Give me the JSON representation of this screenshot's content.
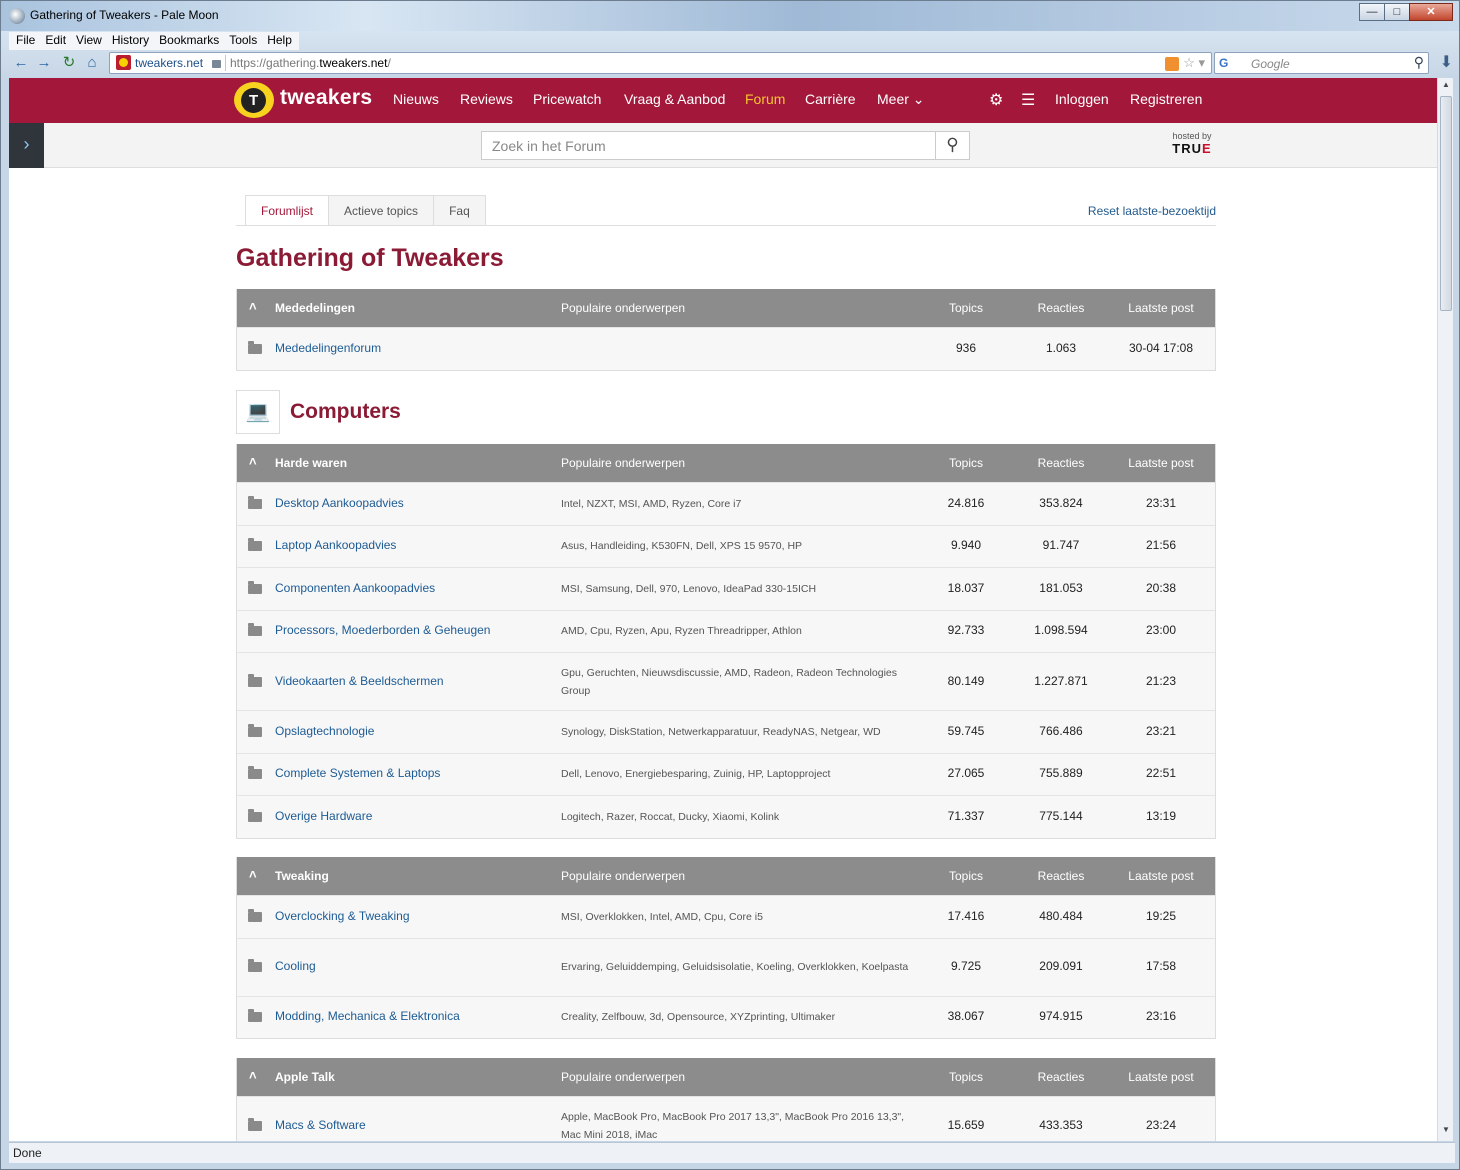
{
  "window": {
    "title": "Gathering of Tweakers - Pale Moon"
  },
  "menu": [
    "File",
    "Edit",
    "View",
    "History",
    "Bookmarks",
    "Tools",
    "Help"
  ],
  "address": {
    "site": "tweakers.net",
    "url_prefix": "https://gathering.",
    "url_domain": "tweakers.net",
    "url_suffix": "/"
  },
  "browser_search": {
    "engine": "G",
    "placeholder": "Google"
  },
  "status": "Done",
  "site": {
    "logo_text": "tweakers",
    "nav": [
      "Nieuws",
      "Reviews",
      "Pricewatch",
      "Vraag & Aanbod",
      "Forum",
      "Carrière",
      "Meer"
    ],
    "login": "Inloggen",
    "register": "Registreren",
    "search_placeholder": "Zoek in het Forum",
    "hosted_by": "hosted by",
    "hosted_logo": "TRU",
    "hosted_logo_accent": "E"
  },
  "tabs": [
    "Forumlijst",
    "Actieve topics",
    "Faq"
  ],
  "reset_link": "Reset laatste-bezoektijd",
  "page_title": "Gathering of Tweakers",
  "col_headers": {
    "popular": "Populaire onderwerpen",
    "topics": "Topics",
    "reacties": "Reacties",
    "last": "Laatste post"
  },
  "category": {
    "name": "Computers",
    "icon": "laptop-icon"
  },
  "sections": [
    {
      "name": "Mededelingen",
      "forums": [
        {
          "name": "Mededelingenforum",
          "popular": "",
          "topics": "936",
          "reacties": "1.063",
          "last": "30-04 17:08"
        }
      ]
    },
    {
      "name": "Harde waren",
      "forums": [
        {
          "name": "Desktop Aankoopadvies",
          "popular": "Intel, NZXT, MSI, AMD, Ryzen, Core i7",
          "topics": "24.816",
          "reacties": "353.824",
          "last": "23:31"
        },
        {
          "name": "Laptop Aankoopadvies",
          "popular": "Asus, Handleiding, K530FN, Dell, XPS 15 9570, HP",
          "topics": "9.940",
          "reacties": "91.747",
          "last": "21:56"
        },
        {
          "name": "Componenten Aankoopadvies",
          "popular": "MSI, Samsung, Dell, 970, Lenovo, IdeaPad 330-15ICH",
          "topics": "18.037",
          "reacties": "181.053",
          "last": "20:38"
        },
        {
          "name": "Processors, Moederborden & Geheugen",
          "popular": "AMD, Cpu, Ryzen, Apu, Ryzen Threadripper, Athlon",
          "topics": "92.733",
          "reacties": "1.098.594",
          "last": "23:00"
        },
        {
          "name": "Videokaarten & Beeldschermen",
          "popular": "Gpu, Geruchten, Nieuwsdiscussie, AMD, Radeon, Radeon Technologies Group",
          "topics": "80.149",
          "reacties": "1.227.871",
          "last": "21:23"
        },
        {
          "name": "Opslagtechnologie",
          "popular": "Synology, DiskStation, Netwerkapparatuur, ReadyNAS, Netgear, WD",
          "topics": "59.745",
          "reacties": "766.486",
          "last": "23:21"
        },
        {
          "name": "Complete Systemen & Laptops",
          "popular": "Dell, Lenovo, Energiebesparing, Zuinig, HP, Laptopproject",
          "topics": "27.065",
          "reacties": "755.889",
          "last": "22:51"
        },
        {
          "name": "Overige Hardware",
          "popular": "Logitech, Razer, Roccat, Ducky, Xiaomi, Kolink",
          "topics": "71.337",
          "reacties": "775.144",
          "last": "13:19"
        }
      ]
    },
    {
      "name": "Tweaking",
      "forums": [
        {
          "name": "Overclocking & Tweaking",
          "popular": "MSI, Overklokken, Intel, AMD, Cpu, Core i5",
          "topics": "17.416",
          "reacties": "480.484",
          "last": "19:25"
        },
        {
          "name": "Cooling",
          "popular": "Ervaring, Geluiddemping, Geluidsisolatie, Koeling, Overklokken, Koelpasta",
          "topics": "9.725",
          "reacties": "209.091",
          "last": "17:58"
        },
        {
          "name": "Modding, Mechanica & Elektronica",
          "popular": "Creality, Zelfbouw, 3d, Opensource, XYZprinting, Ultimaker",
          "topics": "38.067",
          "reacties": "974.915",
          "last": "23:16"
        }
      ]
    },
    {
      "name": "Apple Talk",
      "forums": [
        {
          "name": "Macs & Software",
          "popular": "Apple, MacBook Pro, MacBook Pro 2017 13,3\", MacBook Pro 2016 13,3\", Mac Mini 2018, iMac",
          "topics": "15.659",
          "reacties": "433.353",
          "last": "23:24"
        }
      ]
    }
  ]
}
